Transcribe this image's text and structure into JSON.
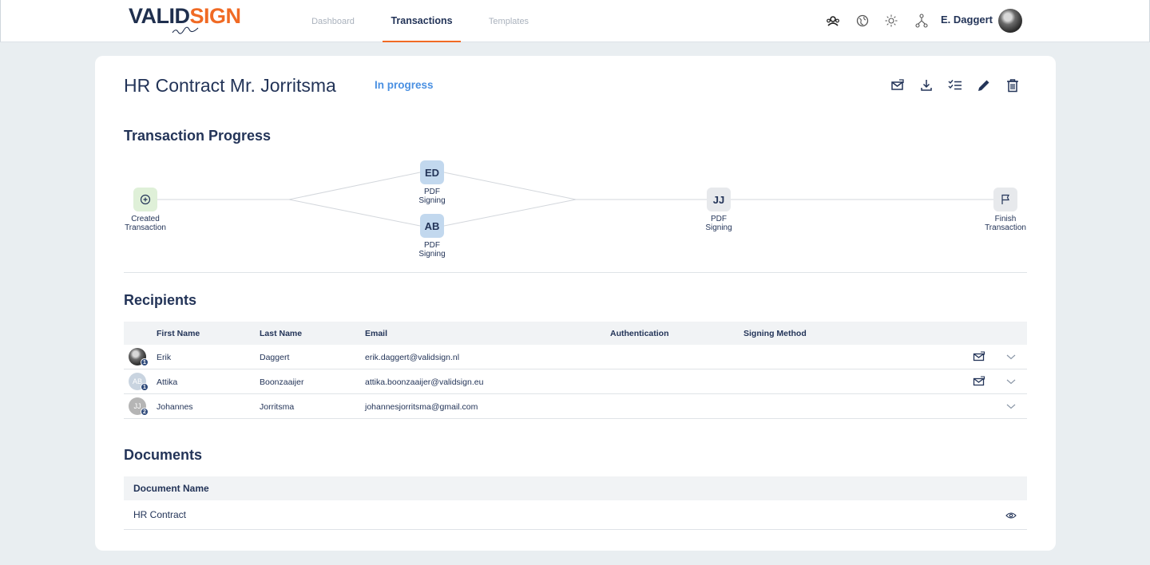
{
  "brand": {
    "logo_part1": "VALID",
    "logo_part2": "SIGN"
  },
  "nav": {
    "items": [
      "Dashboard",
      "Transactions",
      "Templates"
    ],
    "active": "Transactions"
  },
  "header_icons": [
    "people-icon",
    "globe-icon",
    "sun-icon",
    "org-chart-icon"
  ],
  "user": {
    "name": "E. Daggert"
  },
  "transaction": {
    "title": "HR Contract Mr. Jorritsma",
    "status": "In progress",
    "status_color": "#4a90e2",
    "toolbar_icons": [
      "resend-mail-icon",
      "download-icon",
      "checklist-icon",
      "edit-icon",
      "trash-icon"
    ]
  },
  "progress": {
    "section_title": "Transaction Progress",
    "nodes": [
      {
        "id": "created",
        "icon": "plus-circle-icon",
        "label_line1": "Created",
        "label_line2": "Transaction"
      },
      {
        "id": "ed",
        "initials": "ED",
        "label_line1": "PDF",
        "label_line2": "Signing"
      },
      {
        "id": "ab",
        "initials": "AB",
        "label_line1": "PDF",
        "label_line2": "Signing"
      },
      {
        "id": "jj",
        "initials": "JJ",
        "label_line1": "PDF",
        "label_line2": "Signing"
      },
      {
        "id": "finish",
        "icon": "flag-icon",
        "label_line1": "Finish",
        "label_line2": "Transaction"
      }
    ]
  },
  "recipients": {
    "section_title": "Recipients",
    "columns": [
      "First Name",
      "Last Name",
      "Email",
      "Authentication",
      "Signing Method"
    ],
    "rows": [
      {
        "avatar_type": "photo",
        "avatar_text": "",
        "order": "1",
        "first": "Erik",
        "last": "Daggert",
        "email": "erik.daggert@validsign.nl",
        "auth": "",
        "method": "",
        "has_mail_icon": true
      },
      {
        "avatar_type": "initials",
        "avatar_text": "AB",
        "order": "1",
        "first": "Attika",
        "last": "Boonzaaijer",
        "email": "attika.boonzaaijer@validsign.eu",
        "auth": "",
        "method": "",
        "has_mail_icon": true
      },
      {
        "avatar_type": "initials",
        "avatar_text": "JJ",
        "order": "2",
        "first": "Johannes",
        "last": "Jorritsma",
        "email": "johannesjorritsma@gmail.com",
        "auth": "",
        "method": "",
        "has_mail_icon": false
      }
    ]
  },
  "documents": {
    "section_title": "Documents",
    "column": "Document Name",
    "rows": [
      {
        "name": "HR Contract"
      }
    ]
  }
}
